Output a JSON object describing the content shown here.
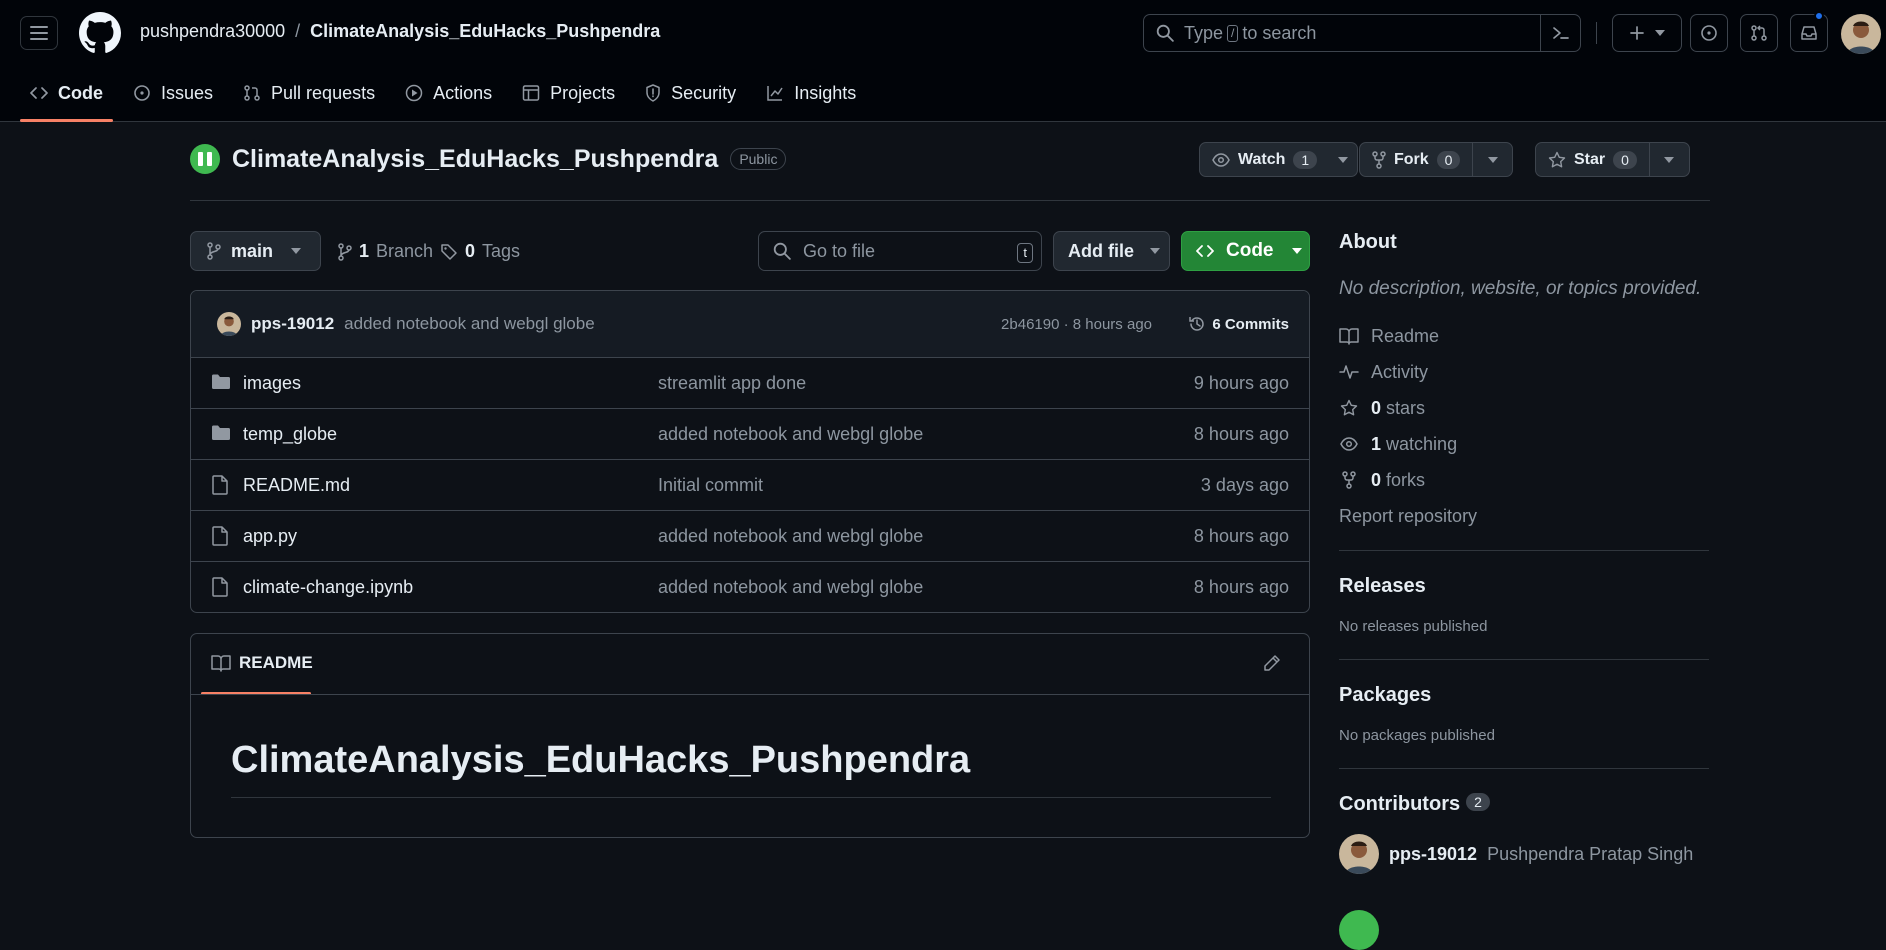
{
  "header": {
    "owner": "pushpendra30000",
    "separator": "/",
    "repo": "ClimateAnalysis_EduHacks_Pushpendra",
    "search_pre": "Type",
    "search_key": "/",
    "search_post": "to search"
  },
  "tabs": [
    {
      "label": "Code"
    },
    {
      "label": "Issues"
    },
    {
      "label": "Pull requests"
    },
    {
      "label": "Actions"
    },
    {
      "label": "Projects"
    },
    {
      "label": "Security"
    },
    {
      "label": "Insights"
    }
  ],
  "repo": {
    "name": "ClimateAnalysis_EduHacks_Pushpendra",
    "visibility": "Public",
    "watch_label": "Watch",
    "watch_count": "1",
    "fork_label": "Fork",
    "fork_count": "0",
    "star_label": "Star",
    "star_count": "0"
  },
  "nav": {
    "branch": "main",
    "branches_count": "1",
    "branches_label": "Branch",
    "tags_count": "0",
    "tags_label": "Tags",
    "goto_placeholder": "Go to file",
    "goto_key": "t",
    "add_file": "Add file",
    "code": "Code"
  },
  "commit": {
    "author": "pps-19012",
    "message": "added notebook and webgl globe",
    "hash_time": "2b46190 · 8 hours ago",
    "commits": "6 Commits"
  },
  "files": [
    {
      "name": "images",
      "type": "folder",
      "message": "streamlit app done",
      "time": "9 hours ago"
    },
    {
      "name": "temp_globe",
      "type": "folder",
      "message": "added notebook and webgl globe",
      "time": "8 hours ago"
    },
    {
      "name": "README.md",
      "type": "file",
      "message": "Initial commit",
      "time": "3 days ago"
    },
    {
      "name": "app.py",
      "type": "file",
      "message": "added notebook and webgl globe",
      "time": "8 hours ago"
    },
    {
      "name": "climate-change.ipynb",
      "type": "file",
      "message": "added notebook and webgl globe",
      "time": "8 hours ago"
    }
  ],
  "readme": {
    "tab": "README",
    "heading": "ClimateAnalysis_EduHacks_Pushpendra"
  },
  "about": {
    "title": "About",
    "description": "No description, website, or topics provided.",
    "readme": "Readme",
    "activity": "Activity",
    "stars_count": "0",
    "stars_label": "stars",
    "watching_count": "1",
    "watching_label": "watching",
    "forks_count": "0",
    "forks_label": "forks",
    "report": "Report repository"
  },
  "releases": {
    "title": "Releases",
    "empty": "No releases published"
  },
  "packages": {
    "title": "Packages",
    "empty": "No packages published"
  },
  "contributors": {
    "title": "Contributors",
    "count": "2",
    "items": [
      {
        "login": "pps-19012",
        "name": "Pushpendra Pratap Singh"
      }
    ]
  },
  "colors": {
    "accent": "#f78166",
    "primary_button": "#238636",
    "link_blue": "#1f6feb"
  }
}
